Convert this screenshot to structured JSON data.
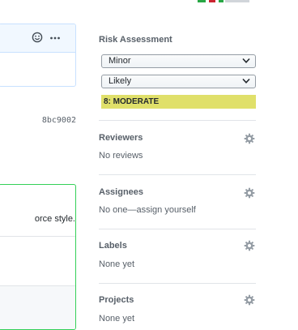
{
  "commit": {
    "sha": "8bc9002"
  },
  "comment": {
    "text_fragment": "orce style."
  },
  "sidebar": {
    "risk": {
      "title": "Risk Assessment",
      "impact": "Minor",
      "likelihood": "Likely",
      "result": "8: MODERATE",
      "result_color": "#e0e06a"
    },
    "reviewers": {
      "title": "Reviewers",
      "value": "No reviews"
    },
    "assignees": {
      "title": "Assignees",
      "value": "No one—assign yourself"
    },
    "labels": {
      "title": "Labels",
      "value": "None yet"
    },
    "projects": {
      "title": "Projects",
      "value": "None yet"
    }
  },
  "colors": {
    "accent_border": "#c8e1ff",
    "success_border": "#34d058",
    "muted": "#586069"
  }
}
